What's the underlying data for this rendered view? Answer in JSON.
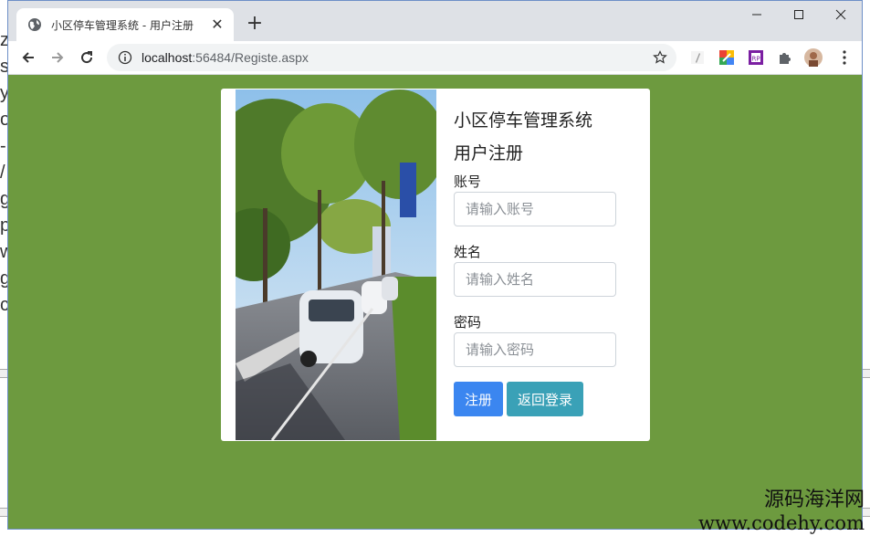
{
  "background": {
    "left_fragments": [
      "z",
      "s",
      "y",
      "o",
      "-",
      "/",
      "g",
      "p",
      "w",
      "g",
      "c"
    ]
  },
  "browser": {
    "tab": {
      "title": "小区停车管理系统 - 用户注册",
      "icon": "globe-icon"
    },
    "url": {
      "host": "localhost",
      "rest": ":56484/Registe.aspx"
    }
  },
  "card": {
    "system_title": "小区停车管理系统",
    "form_title": "用户注册",
    "fields": [
      {
        "label": "账号",
        "placeholder": "请输入账号"
      },
      {
        "label": "姓名",
        "placeholder": "请输入姓名"
      },
      {
        "label": "密码",
        "placeholder": "请输入密码"
      }
    ],
    "register_label": "注册",
    "back_label": "返回登录"
  },
  "watermark": {
    "cn": "源码海洋网",
    "url": "www.codehy.com"
  },
  "colors": {
    "page_bg": "#6d9a3f",
    "primary": "#3b86f0",
    "info": "#3aa1b7"
  }
}
